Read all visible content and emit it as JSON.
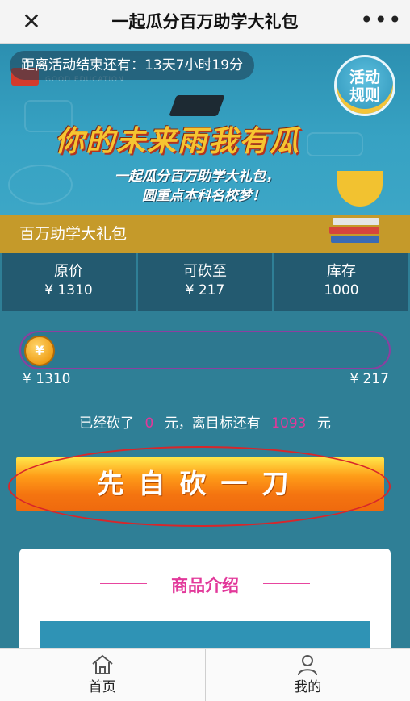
{
  "nav": {
    "title": "一起瓜分百万助学大礼包",
    "close_icon": "close-icon",
    "more_icon": "more-icon"
  },
  "banner": {
    "countdown": "距离活动结束还有：13天7小时19分",
    "rules": "活动规则",
    "slogan": "你的未来雨我有瓜",
    "sub1": "一起瓜分百万助学大礼包，",
    "sub2": "圆重点本科名校梦！"
  },
  "package": {
    "label": "百万助学大礼包"
  },
  "stats": [
    {
      "key": "原价",
      "value": "¥ 1310"
    },
    {
      "key": "可砍至",
      "value": "¥ 217"
    },
    {
      "key": "库存",
      "value": "1000"
    }
  ],
  "progress": {
    "coin": "¥",
    "left": "¥ 1310",
    "right": "¥ 217",
    "fraction": 0
  },
  "cut": {
    "pre": "已经砍了",
    "done": "0",
    "mid": "元，离目标还有",
    "remain": "1093",
    "post": "元"
  },
  "button": {
    "label": "先自砍一刀"
  },
  "card": {
    "title": "商品介绍"
  },
  "tabs": [
    {
      "label": "首页",
      "icon": "home-icon"
    },
    {
      "label": "我的",
      "icon": "user-icon"
    }
  ],
  "colors": {
    "accent": "#e2389a",
    "gold": "#c59a2a",
    "button": "#f47410",
    "bg": "#2f7f96"
  }
}
